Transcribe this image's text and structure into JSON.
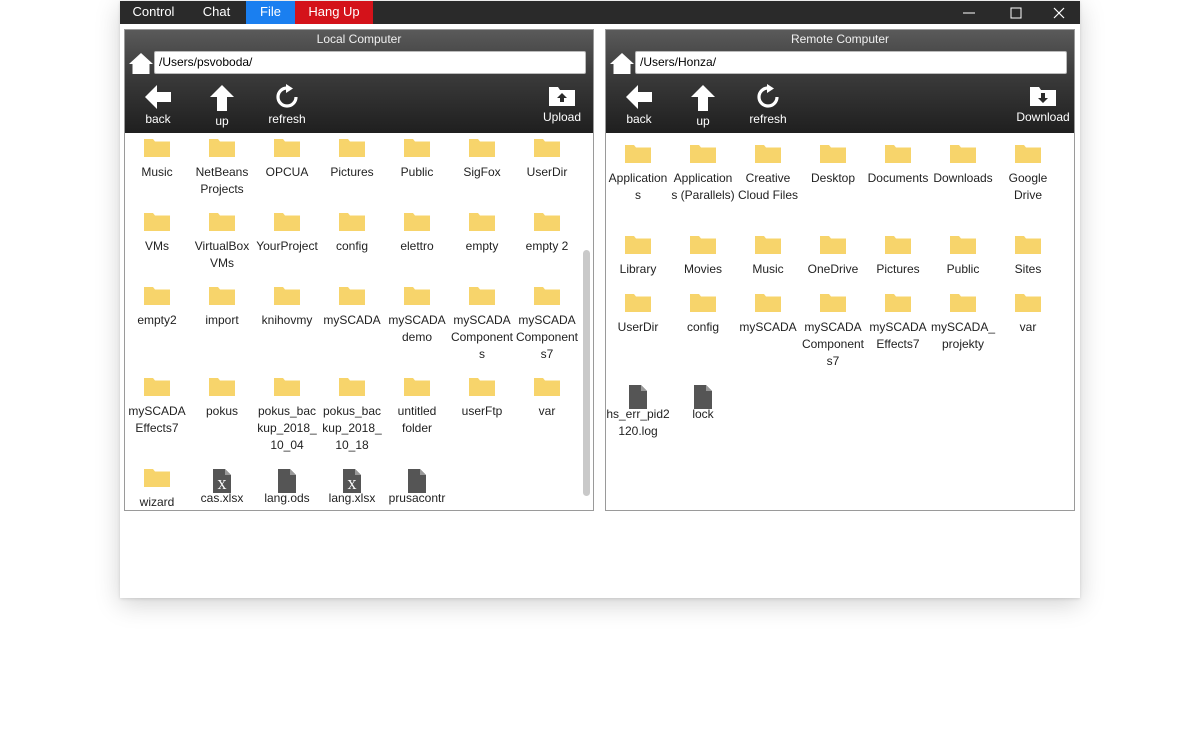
{
  "tabs": {
    "control": "Control",
    "chat": "Chat",
    "file": "File",
    "hangup": "Hang Up"
  },
  "colors": {
    "file_tab": "#1a7ff0",
    "hangup_tab": "#d4121a",
    "folder": "#f7d46b",
    "file_icon": "#555555"
  },
  "local": {
    "title": "Local Computer",
    "path": "/Users/psvoboda/",
    "buttons": {
      "back": "back",
      "up": "up",
      "refresh": "refresh",
      "upload": "Upload"
    },
    "items": [
      {
        "name": "Music",
        "type": "folder"
      },
      {
        "name": "NetBeans Projects",
        "type": "folder"
      },
      {
        "name": "OPCUA",
        "type": "folder"
      },
      {
        "name": "Pictures",
        "type": "folder"
      },
      {
        "name": "Public",
        "type": "folder"
      },
      {
        "name": "SigFox",
        "type": "folder"
      },
      {
        "name": "UserDir",
        "type": "folder"
      },
      {
        "name": "VMs",
        "type": "folder"
      },
      {
        "name": "VirtualBox VMs",
        "type": "folder"
      },
      {
        "name": "YourProject",
        "type": "folder"
      },
      {
        "name": "config",
        "type": "folder"
      },
      {
        "name": "elettro",
        "type": "folder"
      },
      {
        "name": "empty",
        "type": "folder"
      },
      {
        "name": "empty 2",
        "type": "folder"
      },
      {
        "name": "empty2",
        "type": "folder"
      },
      {
        "name": "import",
        "type": "folder"
      },
      {
        "name": "knihovmy",
        "type": "folder"
      },
      {
        "name": "mySCADA",
        "type": "folder"
      },
      {
        "name": "mySCADA demo",
        "type": "folder"
      },
      {
        "name": "mySCADA Components",
        "type": "folder"
      },
      {
        "name": "mySCADA Components7",
        "type": "folder"
      },
      {
        "name": "mySCADA Effects7",
        "type": "folder"
      },
      {
        "name": "pokus",
        "type": "folder"
      },
      {
        "name": "pokus_backup_2018_10_04",
        "type": "folder"
      },
      {
        "name": "pokus_backup_2018_10_18",
        "type": "folder"
      },
      {
        "name": "untitled folder",
        "type": "folder"
      },
      {
        "name": "userFtp",
        "type": "folder"
      },
      {
        "name": "var",
        "type": "folder"
      },
      {
        "name": "wizard",
        "type": "folder"
      },
      {
        "name": "cas.xlsx",
        "type": "xlsx"
      },
      {
        "name": "lang.ods",
        "type": "file"
      },
      {
        "name": "lang.xlsx",
        "type": "xlsx"
      },
      {
        "name": "prusacontr",
        "type": "file"
      }
    ]
  },
  "remote": {
    "title": "Remote Computer",
    "path": "/Users/Honza/",
    "buttons": {
      "back": "back",
      "up": "up",
      "refresh": "refresh",
      "download": "Download"
    },
    "items": [
      {
        "name": "Applications",
        "type": "folder"
      },
      {
        "name": "Applications (Parallels)",
        "type": "folder"
      },
      {
        "name": "Creative Cloud Files",
        "type": "folder"
      },
      {
        "name": "Desktop",
        "type": "folder"
      },
      {
        "name": "Documents",
        "type": "folder"
      },
      {
        "name": "Downloads",
        "type": "folder"
      },
      {
        "name": "Google Drive",
        "type": "folder"
      },
      {
        "name": "Library",
        "type": "folder"
      },
      {
        "name": "Movies",
        "type": "folder"
      },
      {
        "name": "Music",
        "type": "folder"
      },
      {
        "name": "OneDrive",
        "type": "folder"
      },
      {
        "name": "Pictures",
        "type": "folder"
      },
      {
        "name": "Public",
        "type": "folder"
      },
      {
        "name": "Sites",
        "type": "folder"
      },
      {
        "name": "UserDir",
        "type": "folder"
      },
      {
        "name": "config",
        "type": "folder"
      },
      {
        "name": "mySCADA",
        "type": "folder"
      },
      {
        "name": "mySCADA Components7",
        "type": "folder"
      },
      {
        "name": "mySCADA Effects7",
        "type": "folder"
      },
      {
        "name": "mySCADA_projekty",
        "type": "folder"
      },
      {
        "name": "var",
        "type": "folder"
      },
      {
        "name": "hs_err_pid2120.log",
        "type": "file"
      },
      {
        "name": "lock",
        "type": "file"
      }
    ]
  }
}
